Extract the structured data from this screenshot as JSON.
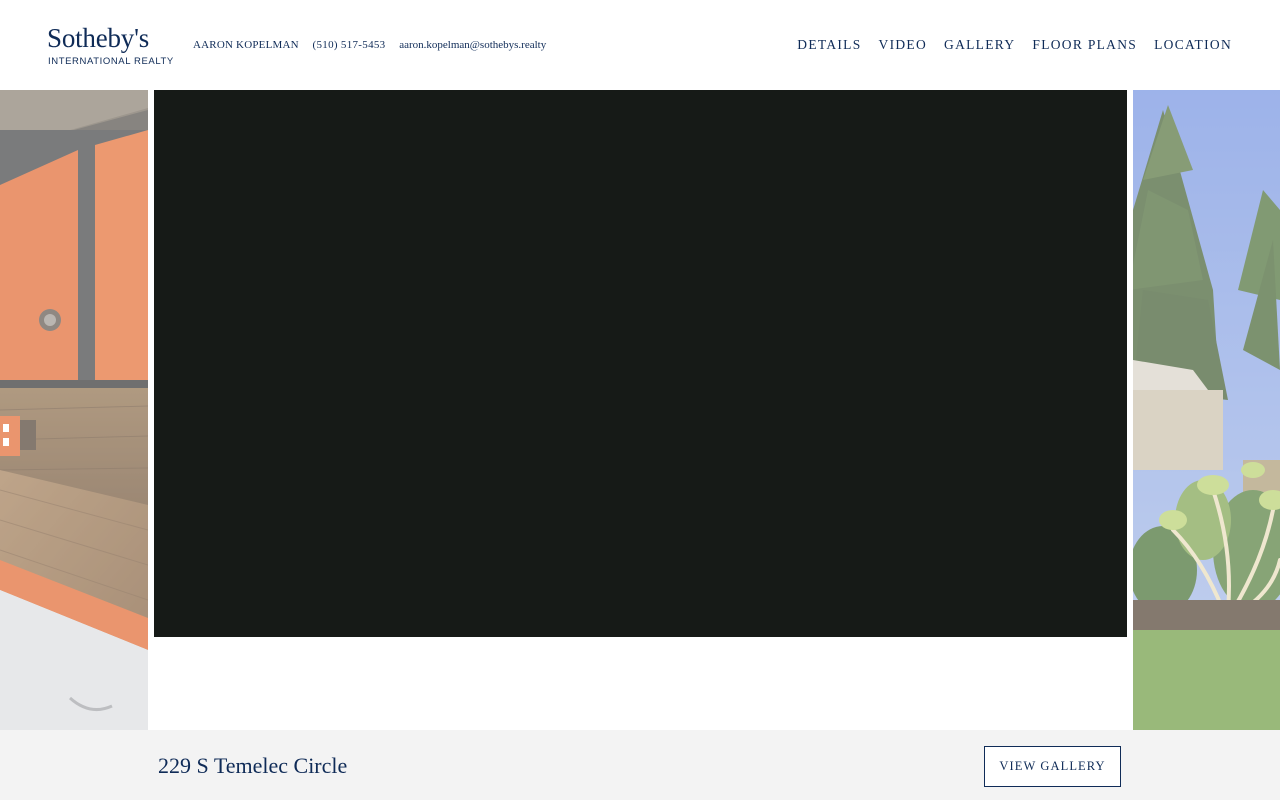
{
  "brand": {
    "name": "Sotheby's",
    "subtitle": "INTERNATIONAL REALTY"
  },
  "agent": {
    "name": "AARON KOPELMAN",
    "phone": "(510) 517-5453",
    "email": "aaron.kopelman@sothebys.realty"
  },
  "nav": {
    "items": [
      {
        "label": "DETAILS"
      },
      {
        "label": "VIDEO"
      },
      {
        "label": "GALLERY"
      },
      {
        "label": "FLOOR PLANS"
      },
      {
        "label": "LOCATION"
      }
    ]
  },
  "gallery": {
    "video_background": "#161a17"
  },
  "footer": {
    "address": "229 S Temelec Circle",
    "view_gallery_label": "VIEW GALLERY"
  },
  "colors": {
    "brand_navy": "#0f2b57",
    "footer_bg": "#f3f3f3"
  }
}
